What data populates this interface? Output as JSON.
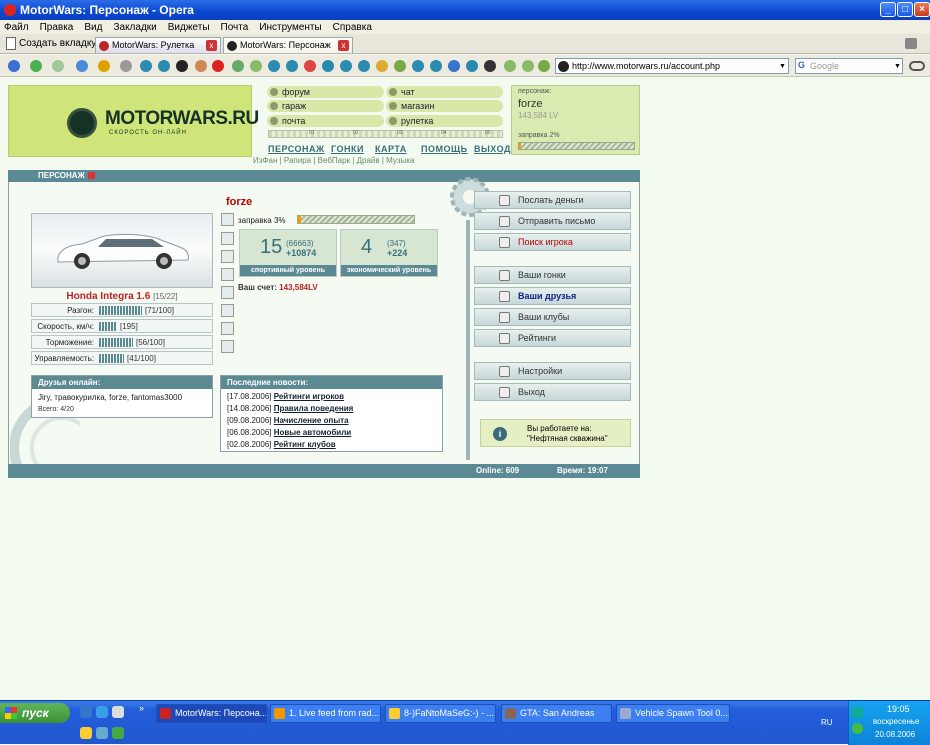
{
  "window": {
    "title": "MotorWars: Персонаж - Opera"
  },
  "menu": [
    "Файл",
    "Правка",
    "Вид",
    "Закладки",
    "Виджеты",
    "Почта",
    "Инструменты",
    "Справка"
  ],
  "tabs": {
    "new_tab": "Создать вкладку",
    "items": [
      {
        "label": "MotorWars: Рулетка"
      },
      {
        "label": "MotorWars: Персонаж"
      }
    ]
  },
  "address": {
    "url": "http://www.motorwars.ru/account.php",
    "search_placeholder": "Google",
    "search_g": "G"
  },
  "site": {
    "logo_text": "MOTORWARS.RU",
    "logo_sub": "СКОРОСТЬ ОН-ЛАЙН",
    "menu_links": [
      "форум",
      "чат",
      "гараж",
      "магазин",
      "почта",
      "рулетка"
    ],
    "progress_ticks": [
      "01",
      "02",
      "03",
      "04",
      "05"
    ],
    "nav": [
      "ПЕРСОНАЖ",
      "ГОНКИ",
      "КАРТА",
      "ПОМОЩЬ",
      "ВЫХОД"
    ],
    "sublinks": "ИзФан | Рапира | ВебПарк | Драйв | Музыка",
    "user_label": "персонаж:",
    "user_name": "forze",
    "user_money": "143,584 LV",
    "user_fuel": "заправка 2%",
    "user_fuel_level": 0.02
  },
  "panel": {
    "title": "ПЕРСОНАЖ",
    "player": "forze",
    "car_name": "Honda Integra 1.6",
    "car_slot": "[15/22]",
    "stats": [
      {
        "label": "Разгон:",
        "value": "[71/100]",
        "level": 0.71
      },
      {
        "label": "Скорость, км/ч:",
        "value": "[195]",
        "level": 0.3
      },
      {
        "label": "Торможение:",
        "value": "[56/100]",
        "level": 0.56
      },
      {
        "label": "Управляемость:",
        "value": "[41/100]",
        "level": 0.41
      }
    ],
    "fuel": "заправка 3%",
    "fuel_level": 0.03,
    "sport": {
      "level": "15",
      "points": "(66663)",
      "gain": "+10874",
      "caption": "спортивный уровень"
    },
    "econ": {
      "level": "4",
      "points": "(347)",
      "gain": "+224",
      "caption": "экономический уровень"
    },
    "account_label": "Ваш счет:",
    "account_value": "143,584LV",
    "friends_title": "Друзья онлайн:",
    "friends_list": "Jiry, травокурилка, forze, fantomas3000",
    "friends_count": "Всего: 4/20",
    "news_title": "Последние новости:",
    "news": [
      {
        "date": "[17.08.2006]",
        "text": "Рейтинги игроков"
      },
      {
        "date": "[14.08.2006]",
        "text": "Правила поведения"
      },
      {
        "date": "[09.08.2006]",
        "text": "Начисление опыта"
      },
      {
        "date": "[06.08.2006]",
        "text": "Новые автомобили"
      },
      {
        "date": "[02.08.2006]",
        "text": "Рейтинг клубов"
      }
    ],
    "actions": [
      "Послать деньги",
      "Отправить письмо",
      "Поиск игрока",
      "Ваши гонки",
      "Ваши друзья",
      "Ваши клубы",
      "Рейтинги",
      "Настройки",
      "Выход"
    ],
    "info_line1": "Вы работаете на:",
    "info_line2": "\"Нефтяная скважина\"",
    "online": "Online: 609",
    "time": "Время: 19:07"
  },
  "taskbar": {
    "start": "пуск",
    "tasks": [
      "MotorWars: Персона...",
      "1. Live feed from rad...",
      "8-)FaNtoMaSeG:-) - ...",
      "GTA: San Andreas",
      "Vehicle Spawn Tool 0...."
    ],
    "lang": "RU",
    "clock": "19:05",
    "day": "воскресенье",
    "date": "20.08.2006"
  },
  "colors": {
    "accent": "#5c8a94",
    "logo_bg": "#cfe57a",
    "brand_red": "#b22222"
  }
}
